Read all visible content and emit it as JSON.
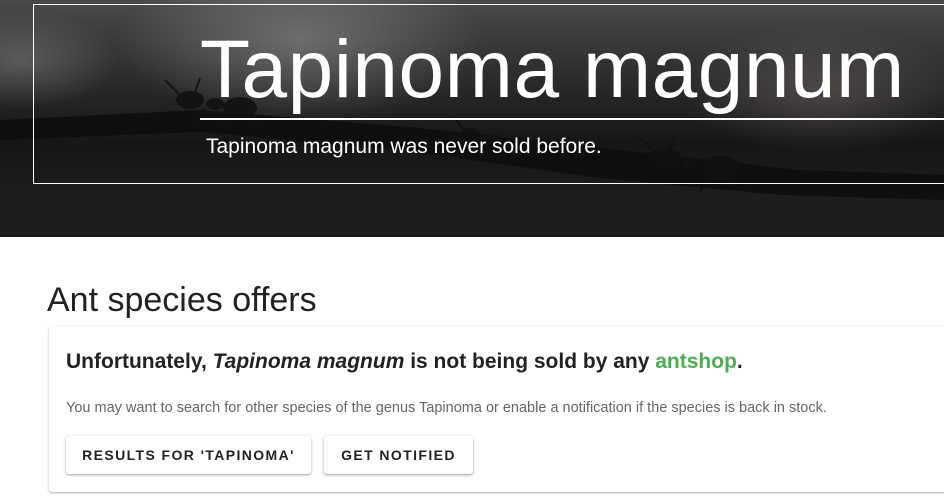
{
  "hero": {
    "title": "Tapinoma magnum",
    "subtitle": "Tapinoma magnum was never sold before."
  },
  "section": {
    "title": "Ant species offers"
  },
  "card": {
    "heading_prefix": "Unfortunately, ",
    "heading_species": "Tapinoma magnum",
    "heading_middle": " is not being sold by any ",
    "heading_link": "antshop",
    "heading_suffix": ".",
    "description": "You may want to search for other species of the genus Tapinoma or enable a notification if the species is back in stock.",
    "results_button_label": "Results for 'Tapinoma'",
    "notify_button_label": "Get notified"
  },
  "colors": {
    "link_green": "#4caf50",
    "hero_text": "#ffffff"
  }
}
